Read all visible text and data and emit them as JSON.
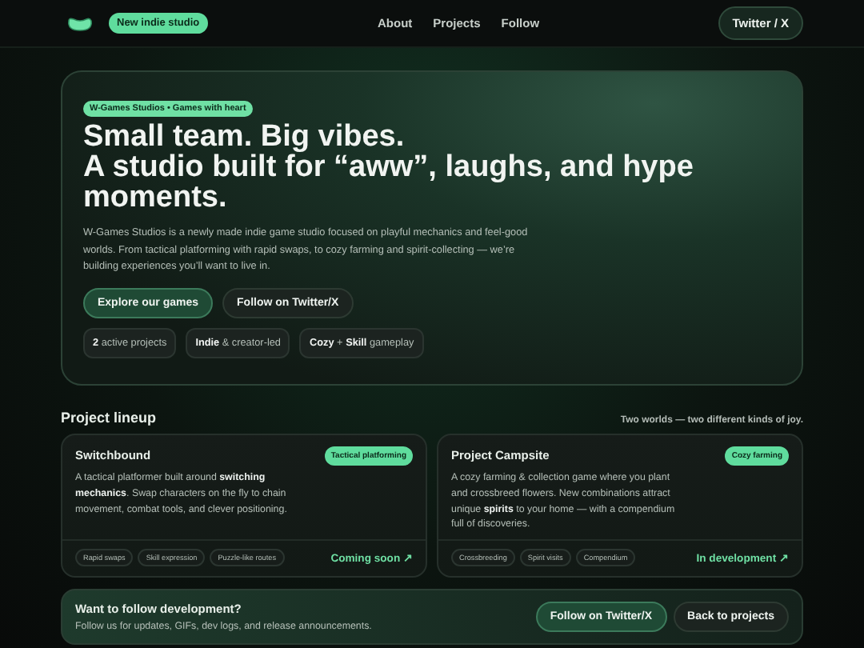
{
  "nav": {
    "badge": "New indie studio",
    "links": [
      "About",
      "Projects",
      "Follow"
    ],
    "cta": "Twitter / X"
  },
  "hero": {
    "eyebrow": "W-Games Studios • Games with heart",
    "title_lines": [
      "Small team. Big vibes.",
      "A studio built for “aww”, laughs, and hype moments."
    ],
    "description": "W-Games Studios is a newly made indie game studio focused on playful mechanics and feel-good worlds. From tactical platforming with rapid swaps, to cozy farming and spirit-collecting — we’re building experiences you’ll want to live in.",
    "buttons": [
      {
        "label": "Explore our games",
        "kind": "primary"
      },
      {
        "label": "Follow on Twitter/X",
        "kind": "secondary"
      }
    ],
    "stats": [
      "**2** active projects",
      "**Indie** & creator-led",
      "**Cozy** + **Skill** gameplay"
    ]
  },
  "lineup": {
    "title": "Project lineup",
    "subtitle": "Two worlds — two different kinds of joy.",
    "projects": [
      {
        "name": "Switchbound",
        "tag": "Tactical platforming",
        "description": "A tactical platformer built around **switching mechanics**. Swap characters on the fly to chain movement, combat tools, and clever positioning.",
        "features": [
          "Rapid swaps",
          "Skill expression",
          "Puzzle-like routes"
        ],
        "status": "Coming soon ↗"
      },
      {
        "name": "Project Campsite",
        "tag": "Cozy farming",
        "description": "A cozy farming & collection game where you plant and crossbreed flowers. New combinations attract unique **spirits** to your home — with a compendium full of discoveries.",
        "features": [
          "Crossbreeding",
          "Spirit visits",
          "Compendium"
        ],
        "status": "In development ↗"
      }
    ]
  },
  "follow": {
    "title": "Want to follow development?",
    "text": "Follow us for updates, GIFs, dev logs, and release announcements.",
    "buttons": [
      {
        "label": "Follow on Twitter/X",
        "kind": "primary"
      },
      {
        "label": "Back to projects",
        "kind": "secondary"
      }
    ]
  }
}
